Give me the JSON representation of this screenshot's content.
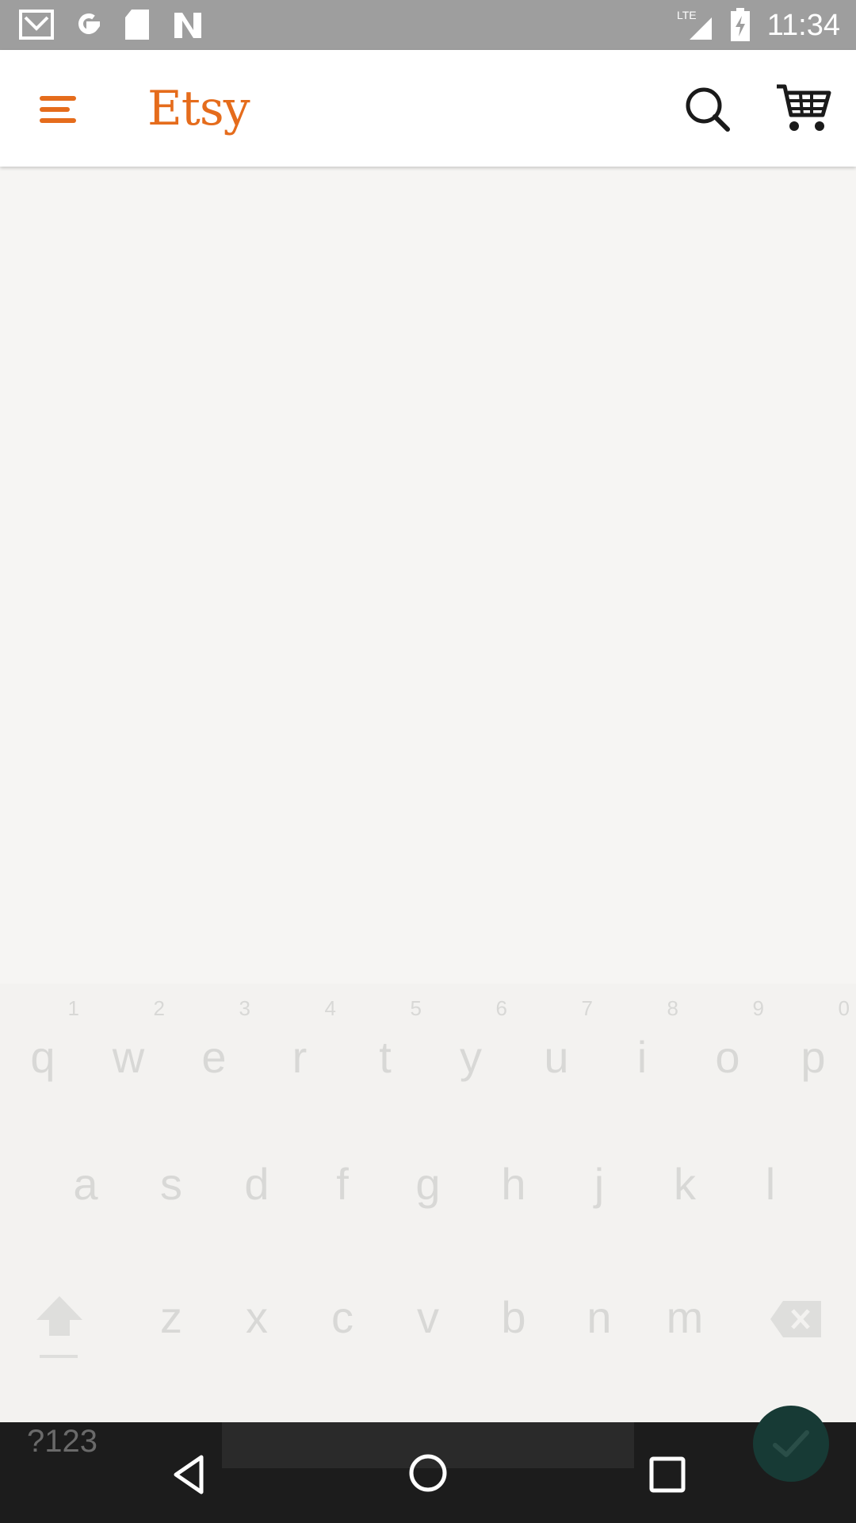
{
  "status_bar": {
    "time": "11:34",
    "network": "LTE",
    "icons": [
      "gmail-icon",
      "google-icon",
      "sd-card-icon",
      "n-icon",
      "lte-signal-icon",
      "battery-icon"
    ]
  },
  "app_bar": {
    "logo": "Etsy",
    "brand_color": "#e56c1c",
    "icons": [
      "menu-icon",
      "search-icon",
      "cart-icon"
    ]
  },
  "keyboard": {
    "row1": [
      {
        "key": "q",
        "hint": "1"
      },
      {
        "key": "w",
        "hint": "2"
      },
      {
        "key": "e",
        "hint": "3"
      },
      {
        "key": "r",
        "hint": "4"
      },
      {
        "key": "t",
        "hint": "5"
      },
      {
        "key": "y",
        "hint": "6"
      },
      {
        "key": "u",
        "hint": "7"
      },
      {
        "key": "i",
        "hint": "8"
      },
      {
        "key": "o",
        "hint": "9"
      },
      {
        "key": "p",
        "hint": "0"
      }
    ],
    "row2": [
      "a",
      "s",
      "d",
      "f",
      "g",
      "h",
      "j",
      "k",
      "l"
    ],
    "row3": [
      "z",
      "x",
      "c",
      "v",
      "b",
      "n",
      "m"
    ],
    "symbols_label": "?123"
  },
  "nav_bar": {
    "icons": [
      "back-icon",
      "home-icon",
      "recents-icon"
    ]
  }
}
